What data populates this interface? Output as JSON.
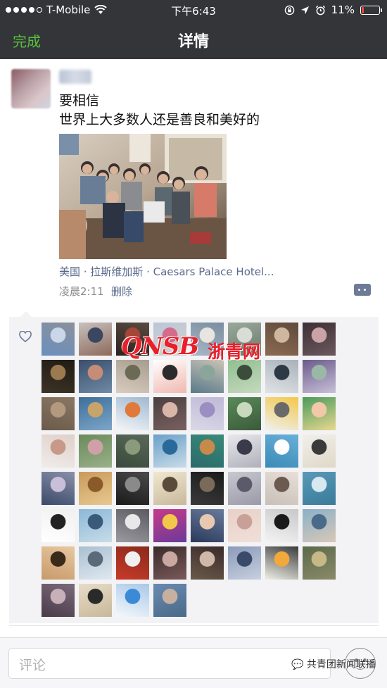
{
  "status_bar": {
    "carrier": "T-Mobile",
    "time": "下午6:43",
    "battery_percent": "11%",
    "battery_level": 0.11,
    "battery_color": "#e94b3c"
  },
  "nav": {
    "done_label": "完成",
    "title": "详情",
    "done_color": "#58c33d"
  },
  "post": {
    "text_line1": "要相信",
    "text_line2": "世界上大多数人还是善良和美好的",
    "location": "美国 · 拉斯维加斯 · Caesars Palace Hotel...",
    "time": "凌晨2:11",
    "delete_label": "删除",
    "link_color": "#5a6a8c"
  },
  "likes": {
    "icon": "heart-icon",
    "avatars": [
      {
        "colors": [
          "#6b8fbf",
          "#c9d7e8",
          "#8a9099"
        ]
      },
      {
        "colors": [
          "#c7c0bf",
          "#3b4660",
          "#8e6a5a"
        ]
      },
      {
        "colors": [
          "#2b2320",
          "#a4453a",
          "#5a4a40"
        ]
      },
      {
        "colors": [
          "#b9c7d9",
          "#d46b8c",
          "#d9d0c8"
        ]
      },
      {
        "colors": [
          "#a9b7c8",
          "#e8e4df",
          "#7a8da0"
        ]
      },
      {
        "colors": [
          "#9aa99b",
          "#d8ddd5",
          "#6d7a6e"
        ]
      },
      {
        "colors": [
          "#8b6a52",
          "#cfb79d",
          "#5f4a3c"
        ]
      },
      {
        "colors": [
          "#3c2f34",
          "#c9a3a6",
          "#6d5860"
        ]
      },
      {
        "colors": [
          "#3d3426",
          "#9c7a4f",
          "#1f1a14"
        ]
      },
      {
        "colors": [
          "#3a4f6b",
          "#c58d77",
          "#6e8aa6"
        ]
      },
      {
        "colors": [
          "#d9ccc0",
          "#6b6a55",
          "#a59d8e"
        ]
      },
      {
        "colors": [
          "#ffffff",
          "#2b2b2b",
          "#f0b8b0"
        ]
      },
      {
        "colors": [
          "#5a7a8a",
          "#8aa69a",
          "#c9c3b6"
        ]
      },
      {
        "colors": [
          "#8fbf8e",
          "#3b4d3a",
          "#c7d9c0"
        ]
      },
      {
        "colors": [
          "#e0e3e6",
          "#2d3a46",
          "#a8b2ba"
        ]
      },
      {
        "colors": [
          "#6b5a8a",
          "#9ab8a6",
          "#c8c0d8"
        ]
      },
      {
        "colors": [
          "#6b5a4a",
          "#b39a7e",
          "#8a7864"
        ]
      },
      {
        "colors": [
          "#3d6e9a",
          "#c8a46a",
          "#7da6c8"
        ]
      },
      {
        "colors": [
          "#f4f6f8",
          "#e07a3a",
          "#9fb8d0"
        ]
      },
      {
        "colors": [
          "#4a4040",
          "#d9b6a8",
          "#7a6060"
        ]
      },
      {
        "colors": [
          "#d9d9e6",
          "#9a8fc0",
          "#c0b8d8"
        ]
      },
      {
        "colors": [
          "#5a8a5a",
          "#c9d9c0",
          "#3a5a3a"
        ]
      },
      {
        "colors": [
          "#f0f0f0",
          "#6a6a6a",
          "#f2c84a"
        ]
      },
      {
        "colors": [
          "#4a9a5a",
          "#f2c8a8",
          "#e8d890"
        ]
      },
      {
        "colors": [
          "#f0eceb",
          "#c89888",
          "#e0d0c8"
        ]
      },
      {
        "colors": [
          "#6a8a5a",
          "#d0a0a8",
          "#9ab08a"
        ]
      },
      {
        "colors": [
          "#3a4a3a",
          "#8a9a7a",
          "#5a6a5a"
        ]
      },
      {
        "colors": [
          "#6aa0c8",
          "#2a6a9a",
          "#c8dce8"
        ]
      },
      {
        "colors": [
          "#2a6a6a",
          "#c88a4a",
          "#3a8a7a"
        ]
      },
      {
        "colors": [
          "#e8e8ec",
          "#3a3a4a",
          "#b0b0bc"
        ]
      },
      {
        "colors": [
          "#3a8ab8",
          "#ffffff",
          "#6ab0d8"
        ]
      },
      {
        "colors": [
          "#f0f0ea",
          "#3a3a3a",
          "#e0d8c8"
        ]
      },
      {
        "colors": [
          "#3a4a6a",
          "#c8c0d8",
          "#8a90a8"
        ]
      },
      {
        "colors": [
          "#c89a5a",
          "#8a5a2a",
          "#e8c890"
        ]
      },
      {
        "colors": [
          "#1a1a1a",
          "#8a8a8a",
          "#4a4a4a"
        ]
      },
      {
        "colors": [
          "#f0e8d0",
          "#5a4a3a",
          "#c8b89a"
        ]
      },
      {
        "colors": [
          "#3a3a3a",
          "#7a6a5a",
          "#1a1a1a"
        ]
      },
      {
        "colors": [
          "#c8c8d0",
          "#5a5a6a",
          "#9a9aa8"
        ]
      },
      {
        "colors": [
          "#c8c0b8",
          "#6a5a50",
          "#e8e0d8"
        ]
      },
      {
        "colors": [
          "#5a9ab8",
          "#d8e8f0",
          "#3a7a9a"
        ]
      },
      {
        "colors": [
          "#ffffff",
          "#222222",
          "#f0f0f0"
        ]
      },
      {
        "colors": [
          "#8ab8d8",
          "#3a5a7a",
          "#c8dce8"
        ]
      },
      {
        "colors": [
          "#9a9aa0",
          "#e8e8ea",
          "#5a5a60"
        ]
      },
      {
        "colors": [
          "#c83a8a",
          "#f2c84a",
          "#6a3a9a"
        ]
      },
      {
        "colors": [
          "#2a3a5a",
          "#e8c8b0",
          "#6a7a9a"
        ]
      },
      {
        "colors": [
          "#e8d0c8",
          "#c8a098",
          "#f0e0d8"
        ]
      },
      {
        "colors": [
          "#f4f4f4",
          "#1a1a1a",
          "#c8c8c8"
        ]
      },
      {
        "colors": [
          "#8ab0c8",
          "#4a6a8a",
          "#d8c8b8"
        ]
      },
      {
        "colors": [
          "#c89a6a",
          "#3a2a1a",
          "#e8c8a0"
        ]
      },
      {
        "colors": [
          "#a8c0d0",
          "#5a6a7a",
          "#e0e8f0"
        ]
      },
      {
        "colors": [
          "#c83a2a",
          "#f0f0f0",
          "#8a2a1a"
        ]
      },
      {
        "colors": [
          "#3a2a2a",
          "#c8a8a0",
          "#7a5a5a"
        ]
      },
      {
        "colors": [
          "#6a5a4a",
          "#d0b8a8",
          "#3a2a2a"
        ]
      },
      {
        "colors": [
          "#8a9ab8",
          "#3a4a6a",
          "#c8d0e0"
        ]
      },
      {
        "colors": [
          "#f0f0e8",
          "#f2a83a",
          "#3a3a3a"
        ]
      },
      {
        "colors": [
          "#5a6a4a",
          "#c8b888",
          "#8a8a6a"
        ]
      },
      {
        "colors": [
          "#4a3a4a",
          "#c8b0b8",
          "#7a6a7a"
        ]
      },
      {
        "colors": [
          "#e8dcc8",
          "#2a2a2a",
          "#c8b89a"
        ]
      },
      {
        "colors": [
          "#f4f8fc",
          "#3a8ad8",
          "#a8c8e8"
        ]
      },
      {
        "colors": [
          "#6a8ab0",
          "#c8b0a0",
          "#4a6a8a"
        ]
      }
    ]
  },
  "watermark": {
    "latin": "QNSB",
    "cn": "浙青网"
  },
  "comment_box": {
    "placeholder": "评论",
    "emoji_icon": "emoji-face-icon"
  },
  "source_label": "共青团新闻联播"
}
